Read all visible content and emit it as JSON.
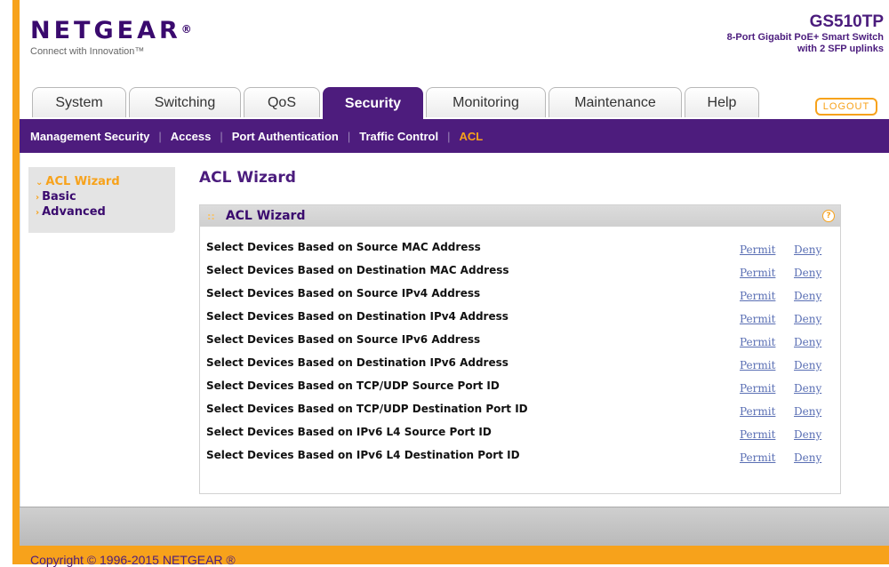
{
  "header": {
    "brand": "NETGEAR",
    "tagline": "Connect with Innovation™",
    "model": "GS510TP",
    "description_line1": "8-Port Gigabit PoE+ Smart Switch",
    "description_line2": "with 2 SFP uplinks"
  },
  "tabs": [
    {
      "label": "System"
    },
    {
      "label": "Switching"
    },
    {
      "label": "QoS"
    },
    {
      "label": "Security"
    },
    {
      "label": "Monitoring"
    },
    {
      "label": "Maintenance"
    },
    {
      "label": "Help"
    }
  ],
  "logout_label": "LOGOUT",
  "subnav": [
    {
      "label": "Management Security"
    },
    {
      "label": "Access"
    },
    {
      "label": "Port Authentication"
    },
    {
      "label": "Traffic Control"
    },
    {
      "label": "ACL"
    }
  ],
  "sidemenu": [
    {
      "label": "ACL Wizard"
    },
    {
      "label": "Basic"
    },
    {
      "label": "Advanced"
    }
  ],
  "page_title": "ACL Wizard",
  "box_title": "ACL Wizard",
  "help_glyph": "?",
  "rows": [
    {
      "label": "Select Devices Based on Source MAC Address",
      "permit": "Permit",
      "deny": "Deny"
    },
    {
      "label": "Select Devices Based on Destination MAC Address",
      "permit": "Permit",
      "deny": "Deny"
    },
    {
      "label": "Select Devices Based on Source IPv4 Address",
      "permit": "Permit",
      "deny": "Deny"
    },
    {
      "label": "Select Devices Based on Destination IPv4 Address",
      "permit": "Permit",
      "deny": "Deny"
    },
    {
      "label": "Select Devices Based on Source IPv6 Address",
      "permit": "Permit",
      "deny": "Deny"
    },
    {
      "label": "Select Devices Based on Destination IPv6 Address",
      "permit": "Permit",
      "deny": "Deny"
    },
    {
      "label": "Select Devices Based on TCP/UDP Source Port ID",
      "permit": "Permit",
      "deny": "Deny"
    },
    {
      "label": "Select Devices Based on TCP/UDP Destination Port ID",
      "permit": "Permit",
      "deny": "Deny"
    },
    {
      "label": "Select Devices Based on IPv6 L4 Source Port ID",
      "permit": "Permit",
      "deny": "Deny"
    },
    {
      "label": "Select Devices Based on IPv6 L4 Destination Port ID",
      "permit": "Permit",
      "deny": "Deny"
    }
  ],
  "footer": {
    "copyright": "Copyright © 1996-2015 NETGEAR ®"
  },
  "colors": {
    "brand_purple": "#4d1c7d",
    "accent_orange": "#f7a21b",
    "link_blue": "#5a6fb4"
  }
}
